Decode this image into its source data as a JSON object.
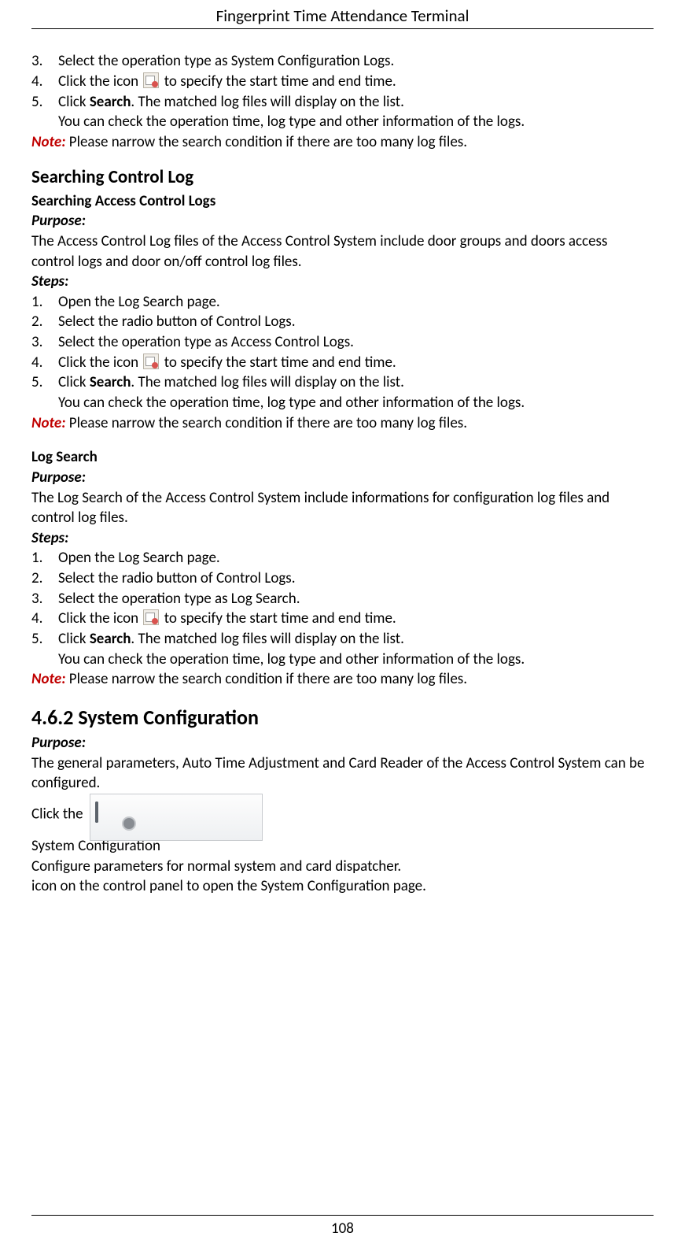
{
  "header": {
    "title": "Fingerprint Time Attendance Terminal"
  },
  "footer": {
    "page": "108"
  },
  "block1": {
    "items": {
      "n3": "3.",
      "t3": "Select the operation type as System Configuration Logs.",
      "n4": "4.",
      "t4a": "Click the icon",
      "t4b": "to specify the start time and end time.",
      "n5": "5.",
      "t5a": "Click ",
      "t5bold": "Search",
      "t5b": ". The matched log files will display on the list.",
      "t5c": "You can check the operation time, log type and other information of the logs."
    },
    "note_label": "Note:",
    "note_text": " Please narrow the search condition if there are too many log files."
  },
  "sec_control": {
    "heading": "Searching Control Log",
    "sub": "Searching Access Control Logs",
    "purpose_label": "Purpose:",
    "purpose_text": "The Access Control Log files of the Access Control System include door groups and doors access control logs and door on/off control log files.",
    "steps_label": "Steps:",
    "items": {
      "n1": "1.",
      "t1": "Open the Log Search page.",
      "n2": "2.",
      "t2": "Select the radio button of Control Logs.",
      "n3": "3.",
      "t3": "Select the operation type as Access Control Logs.",
      "n4": "4.",
      "t4a": "Click the icon",
      "t4b": "to specify the start time and end time.",
      "n5": "5.",
      "t5a": "Click ",
      "t5bold": "Search",
      "t5b": ". The matched log files will display on the list.",
      "t5c": "You can check the operation time, log type and other information of the logs."
    },
    "note_label": "Note:",
    "note_text": " Please narrow the search condition if there are too many log files."
  },
  "sec_logsearch": {
    "heading": "Log Search",
    "purpose_label": "Purpose:",
    "purpose_text": "The Log Search of the Access Control System include informations for configuration log files and control log files.",
    "steps_label": "Steps:",
    "items": {
      "n1": "1.",
      "t1": "Open the Log Search page.",
      "n2": "2.",
      "t2": "Select the radio button of Control Logs.",
      "n3": "3.",
      "t3": "Select the operation type as Log Search.",
      "n4": "4.",
      "t4a": "Click the icon",
      "t4b": "to specify the start time and end time.",
      "n5": "5.",
      "t5a": "Click ",
      "t5bold": "Search",
      "t5b": ". The matched log files will display on the list.",
      "t5c": "You can check the operation time, log type and other information of the logs."
    },
    "note_label": "Note:",
    "note_text": " Please narrow the search condition if there are too many log files."
  },
  "sec_sysconf": {
    "heading_num": "4.6.2 ",
    "heading_text": "System Configuration",
    "purpose_label": "Purpose:",
    "purpose_text": "The general parameters, Auto Time Adjustment and Card Reader of the Access Control System can be configured.",
    "click_a": "Click the ",
    "click_b": " icon on the control panel to open the System Configuration page.",
    "tile_title": "System Configuration",
    "tile_desc": "Configure parameters for normal system and card dispatcher."
  }
}
